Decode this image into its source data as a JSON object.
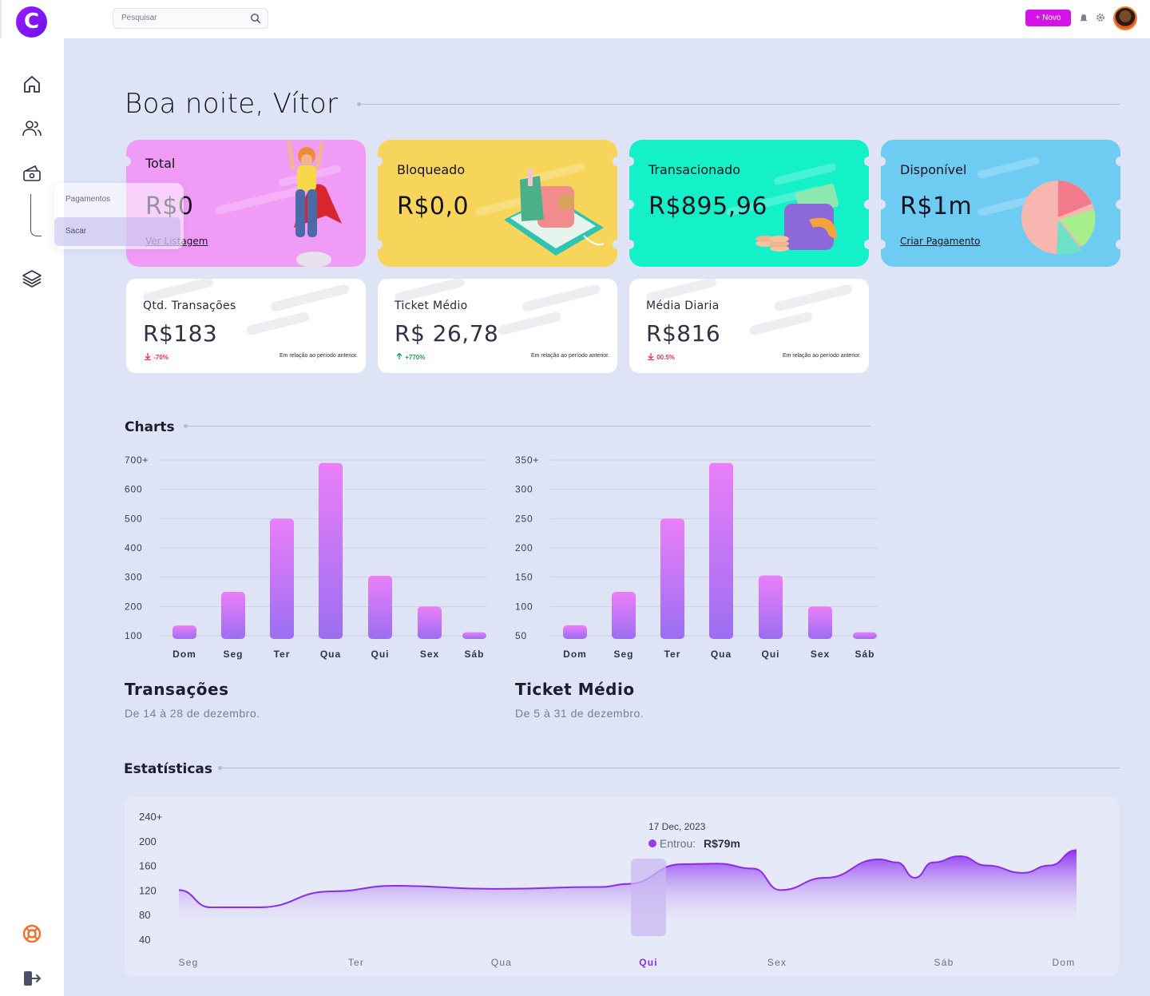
{
  "header": {
    "search_placeholder": "Pesquisar",
    "new_button": "+ Novo",
    "logo_letter": "C"
  },
  "sidebar": {
    "icons": [
      "home-icon",
      "users-icon",
      "wallet-icon",
      "layers-icon",
      "lifebuoy-icon",
      "logout-icon"
    ],
    "submenu": [
      "Pagamentos",
      "Sacar"
    ],
    "active_submenu": "Sacar"
  },
  "greeting": "Boa noite, Vítor",
  "cards": [
    {
      "label": "Total",
      "value": "R$0",
      "link": "Ver Listagem",
      "color": "#f09cf7"
    },
    {
      "label": "Bloqueado",
      "value": "R$0,0",
      "link": "",
      "color": "#f7d55a"
    },
    {
      "label": "Transacionado",
      "value": "R$895,96",
      "link": "",
      "color": "#14f0c8"
    },
    {
      "label": "Disponível",
      "value": "R$1m",
      "link": "Criar Pagamento",
      "color": "#6ecbf2"
    }
  ],
  "stats": [
    {
      "label": "Qtd. Transações",
      "value": "R$183",
      "change": "-70%",
      "direction": "down",
      "note": "Em relação ao período  anterior."
    },
    {
      "label": "Ticket Médio",
      "value": "R$ 26,78",
      "change": "+770%",
      "direction": "up",
      "note": "Em relação ao período  anterior."
    },
    {
      "label": "Média Diaria",
      "value": "R$816",
      "change": "00.5%",
      "direction": "down",
      "note": "Em relação ao período  anterior."
    }
  ],
  "sections": {
    "charts": "Charts",
    "statistics": "Estatísticas"
  },
  "chart_captions": [
    {
      "title": "Transações",
      "subtitle": "De 14 à 28 de dezembro."
    },
    {
      "title": "Ticket Médio",
      "subtitle": "De 5 à 31 de dezembro."
    }
  ],
  "tooltip": {
    "date": "17 Dec, 2023",
    "label": "Entrou:",
    "value": "R$79m"
  },
  "chart_data": [
    {
      "type": "bar",
      "title": "Transações",
      "categories": [
        "Dom",
        "Seg",
        "Ter",
        "Qua",
        "Qui",
        "Sex",
        "Sáb"
      ],
      "values": [
        135,
        250,
        500,
        690,
        305,
        200,
        112
      ],
      "y_ticks": [
        "100",
        "200",
        "300",
        "400",
        "500",
        "600",
        "700+"
      ],
      "ylim": [
        100,
        700
      ]
    },
    {
      "type": "bar",
      "title": "Ticket Médio",
      "categories": [
        "Dom",
        "Seg",
        "Ter",
        "Qua",
        "Qui",
        "Sex",
        "Sáb"
      ],
      "values": [
        68,
        125,
        250,
        345,
        153,
        100,
        56
      ],
      "y_ticks": [
        "50",
        "100",
        "150",
        "200",
        "250",
        "300",
        "350+"
      ],
      "ylim": [
        50,
        350
      ]
    },
    {
      "type": "area",
      "categories": [
        "Seg",
        "Ter",
        "Qua",
        "Qui",
        "Sex",
        "Sáb",
        "Dom"
      ],
      "highlight": "Qui",
      "y_ticks": [
        "40",
        "80",
        "120",
        "160",
        "200",
        "240+"
      ],
      "ylim": [
        40,
        240
      ],
      "x": [
        0,
        0.035,
        0.09,
        0.17,
        0.24,
        0.35,
        0.47,
        0.5,
        0.56,
        0.6,
        0.64,
        0.67,
        0.72,
        0.78,
        0.8,
        0.82,
        0.84,
        0.87,
        0.9,
        0.94,
        0.97,
        1
      ],
      "values": [
        120,
        92,
        92,
        118,
        127,
        122,
        125,
        130,
        162,
        163,
        155,
        120,
        140,
        170,
        165,
        140,
        165,
        175,
        160,
        148,
        160,
        185
      ]
    }
  ]
}
